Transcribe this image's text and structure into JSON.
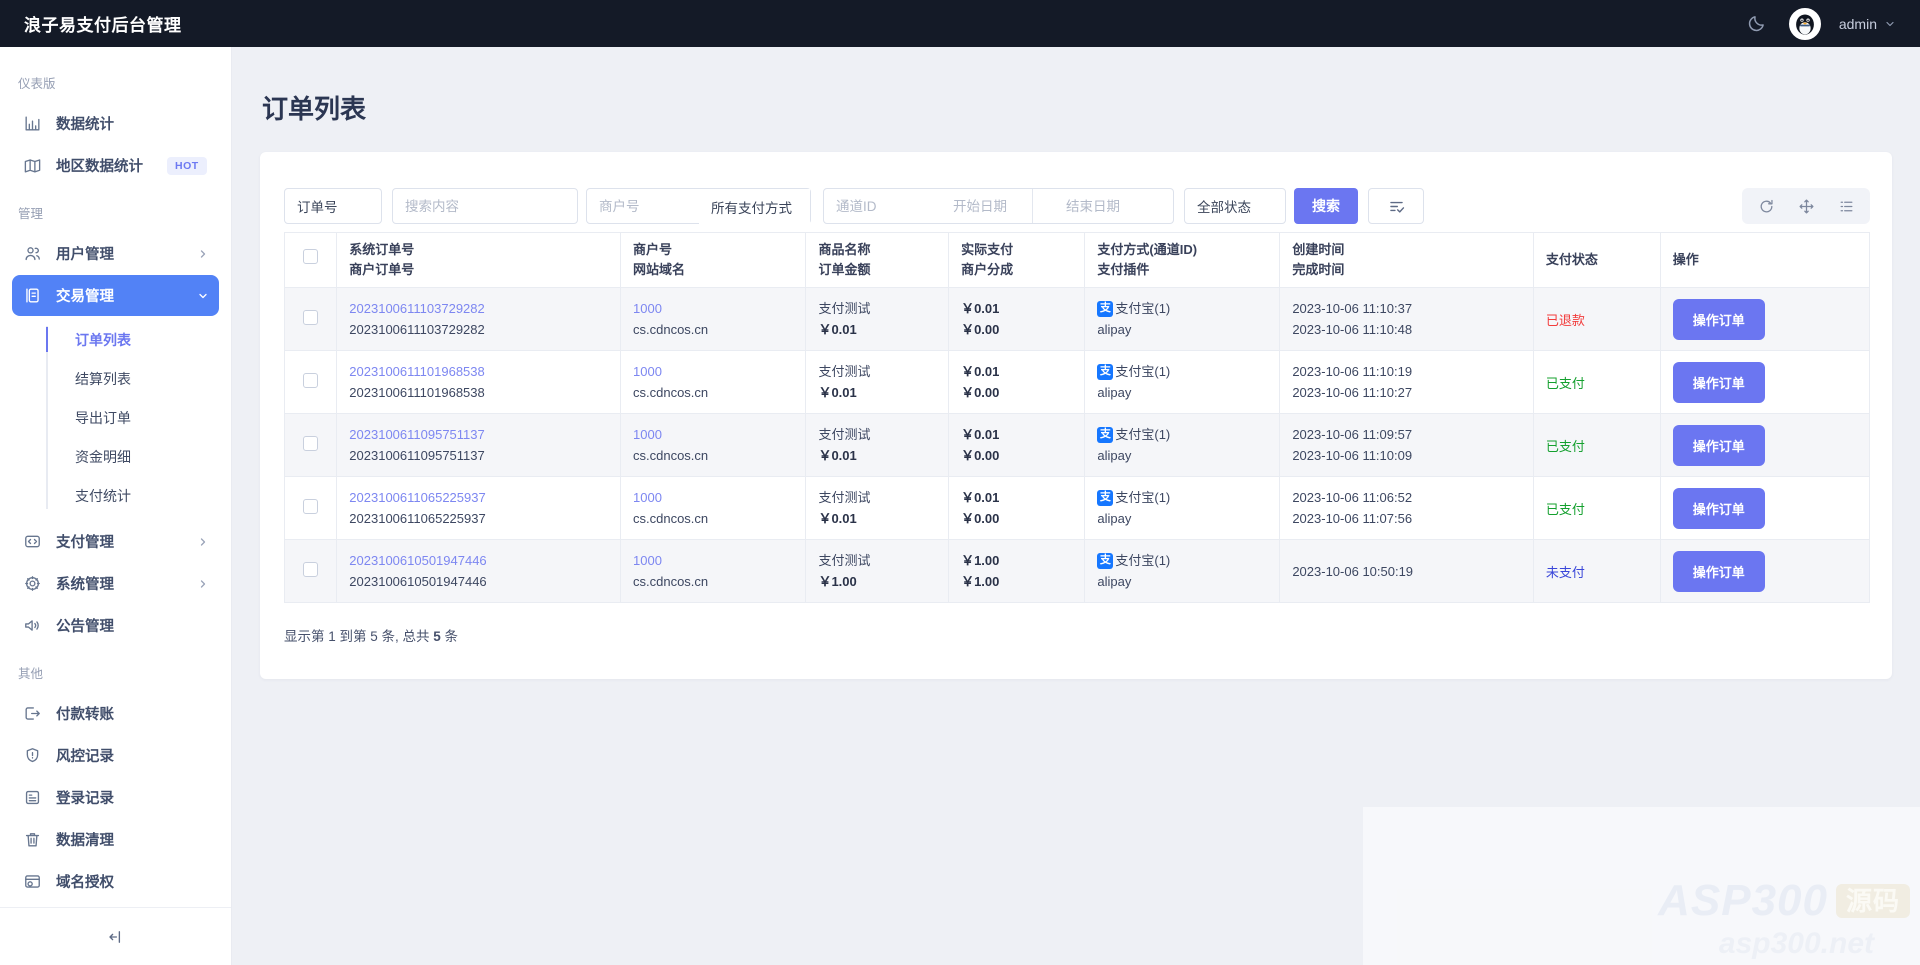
{
  "topbar": {
    "title": "浪子易支付后台管理",
    "username": "admin"
  },
  "sidebar": {
    "sections": [
      {
        "label": "仪表版",
        "items": [
          {
            "label": "数据统计"
          },
          {
            "label": "地区数据统计",
            "badge": "HOT"
          }
        ]
      },
      {
        "label": "管理",
        "items": [
          {
            "label": "用户管理"
          },
          {
            "label": "交易管理",
            "children": [
              "订单列表",
              "结算列表",
              "导出订单",
              "资金明细",
              "支付统计"
            ]
          },
          {
            "label": "支付管理"
          },
          {
            "label": "系统管理"
          },
          {
            "label": "公告管理"
          }
        ]
      },
      {
        "label": "其他",
        "items": [
          {
            "label": "付款转账"
          },
          {
            "label": "风控记录"
          },
          {
            "label": "登录记录"
          },
          {
            "label": "数据清理"
          },
          {
            "label": "域名授权"
          }
        ]
      }
    ]
  },
  "page": {
    "title": "订单列表"
  },
  "filters": {
    "order_no_select": "订单号",
    "search_placeholder": "搜索内容",
    "merchant_placeholder": "商户号",
    "pay_method_select": "所有支付方式",
    "channel_placeholder": "通道ID",
    "start_date_placeholder": "开始日期",
    "end_date_placeholder": "结束日期",
    "status_select": "全部状态",
    "search_button": "搜索"
  },
  "table": {
    "headers": [
      [
        "系统订单号",
        "商户订单号"
      ],
      [
        "商户号",
        "网站域名"
      ],
      [
        "商品名称",
        "订单金额"
      ],
      [
        "实际支付",
        "商户分成"
      ],
      [
        "支付方式(通道ID)",
        "支付插件"
      ],
      [
        "创建时间",
        "完成时间"
      ],
      [
        "支付状态"
      ],
      [
        "操作"
      ]
    ],
    "action_label": "操作订单",
    "rows": [
      {
        "sys_order": "2023100611103729282",
        "merchant_order": "2023100611103729282",
        "merchant_id": "1000",
        "domain": "cs.cdncos.cn",
        "product": "支付测试",
        "order_amount": "￥0.01",
        "paid_amount": "￥0.01",
        "merchant_share": "￥0.00",
        "pay_icon": "支",
        "pay_method": "支付宝(1)",
        "pay_plugin": "alipay",
        "created": "2023-10-06 11:10:37",
        "completed": "2023-10-06 11:10:48",
        "status": "已退款"
      },
      {
        "sys_order": "2023100611101968538",
        "merchant_order": "2023100611101968538",
        "merchant_id": "1000",
        "domain": "cs.cdncos.cn",
        "product": "支付测试",
        "order_amount": "￥0.01",
        "paid_amount": "￥0.01",
        "merchant_share": "￥0.00",
        "pay_icon": "支",
        "pay_method": "支付宝(1)",
        "pay_plugin": "alipay",
        "created": "2023-10-06 11:10:19",
        "completed": "2023-10-06 11:10:27",
        "status": "已支付"
      },
      {
        "sys_order": "2023100611095751137",
        "merchant_order": "2023100611095751137",
        "merchant_id": "1000",
        "domain": "cs.cdncos.cn",
        "product": "支付测试",
        "order_amount": "￥0.01",
        "paid_amount": "￥0.01",
        "merchant_share": "￥0.00",
        "pay_icon": "支",
        "pay_method": "支付宝(1)",
        "pay_plugin": "alipay",
        "created": "2023-10-06 11:09:57",
        "completed": "2023-10-06 11:10:09",
        "status": "已支付"
      },
      {
        "sys_order": "2023100611065225937",
        "merchant_order": "2023100611065225937",
        "merchant_id": "1000",
        "domain": "cs.cdncos.cn",
        "product": "支付测试",
        "order_amount": "￥0.01",
        "paid_amount": "￥0.01",
        "merchant_share": "￥0.00",
        "pay_icon": "支",
        "pay_method": "支付宝(1)",
        "pay_plugin": "alipay",
        "created": "2023-10-06 11:06:52",
        "completed": "2023-10-06 11:07:56",
        "status": "已支付"
      },
      {
        "sys_order": "2023100610501947446",
        "merchant_order": "2023100610501947446",
        "merchant_id": "1000",
        "domain": "cs.cdncos.cn",
        "product": "支付测试",
        "order_amount": "￥1.00",
        "paid_amount": "￥1.00",
        "merchant_share": "￥1.00",
        "pay_icon": "支",
        "pay_method": "支付宝(1)",
        "pay_plugin": "alipay",
        "created": "2023-10-06 10:50:19",
        "completed": "",
        "status": "未支付"
      }
    ],
    "summary": {
      "prefix": "显示第 1 到第 5 条, 总共 ",
      "count": "5",
      "suffix": " 条"
    }
  },
  "watermark": {
    "line1": "ASP300",
    "badge": "源码",
    "line2": "asp300.net"
  },
  "colors": {
    "topbar_bg": "#141a27",
    "accent": "#6b76f1",
    "active_menu": "#5282f6",
    "link": "#7d87f1",
    "status_refunded": "#f23c3c",
    "status_paid": "#14a02e",
    "status_unpaid": "#3946d9",
    "alipay": "#1677ff",
    "hot_badge_bg": "#eceffd"
  }
}
